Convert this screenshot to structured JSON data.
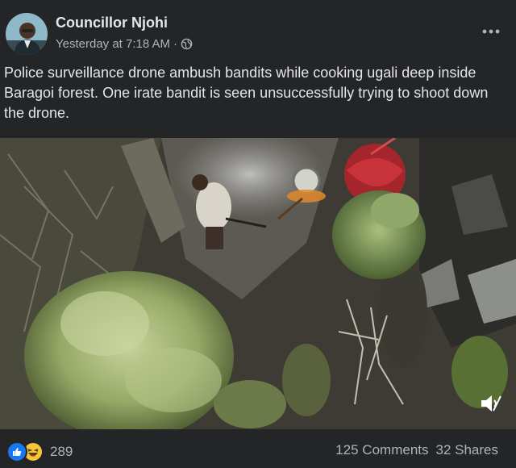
{
  "post": {
    "author": "Councillor Njohi",
    "timestamp": "Yesterday at 7:18 AM",
    "separator": "·",
    "audience_icon": "globe-icon",
    "more_icon": "more-options-icon",
    "text": "Police surveillance drone ambush bandits while cooking ugali deep inside Baragoi forest. One irate bandit is seen unsuccessfully trying to shoot down the drone."
  },
  "video": {
    "volume_icon": "volume-muted-icon"
  },
  "footer": {
    "reactions": [
      "like",
      "haha"
    ],
    "reaction_count": "289",
    "comments": "125 Comments",
    "shares": "32 Shares"
  },
  "colors": {
    "background": "#242526",
    "text_primary": "#e4e6eb",
    "text_secondary": "#b0b3b8",
    "like_blue": "#1877f2",
    "haha_yellow": "#f7c536"
  }
}
